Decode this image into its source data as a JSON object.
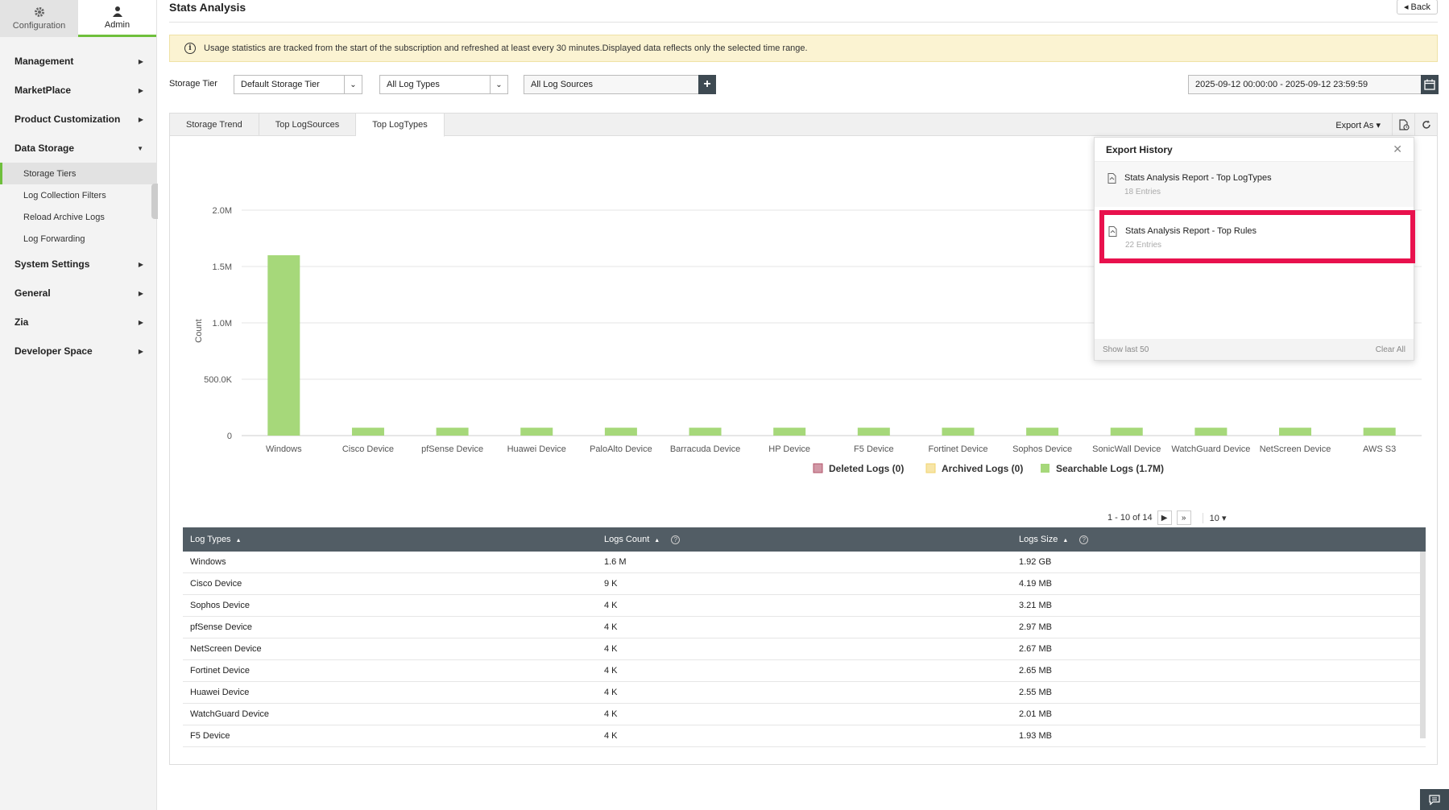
{
  "topnav": {
    "config_label": "Configuration",
    "admin_label": "Admin"
  },
  "sidebar": {
    "items": [
      {
        "label": "Management"
      },
      {
        "label": "MarketPlace"
      },
      {
        "label": "Product Customization"
      },
      {
        "label": "Data Storage"
      },
      {
        "label": "System Settings"
      },
      {
        "label": "General"
      },
      {
        "label": "Zia"
      },
      {
        "label": "Developer Space"
      }
    ],
    "data_storage_sub": [
      "Storage Tiers",
      "Log Collection Filters",
      "Reload Archive Logs",
      "Log Forwarding"
    ]
  },
  "header": {
    "title": "Stats Analysis",
    "back_label": "Back"
  },
  "notice": {
    "text": "Usage statistics are tracked from the start of the subscription and refreshed at least every 30 minutes.Displayed data reflects only the selected time range."
  },
  "filters": {
    "storage_tier_label": "Storage Tier",
    "storage_tier_value": "Default Storage Tier",
    "log_types_value": "All Log Types",
    "log_sources_value": "All Log Sources",
    "date_range": "2025-09-12 00:00:00 - 2025-09-12 23:59:59"
  },
  "tabs": [
    "Storage Trend",
    "Top LogSources",
    "Top LogTypes"
  ],
  "active_tab": "Top LogTypes",
  "export_label": "Export As",
  "colors": {
    "searchable": "#a6d87a",
    "deleted": "#b3536a",
    "archived": "#f1d36c",
    "highlight": "#e8114d",
    "header_dark": "#525d65"
  },
  "chart_data": {
    "type": "bar",
    "categories": [
      "Windows",
      "Cisco Device",
      "pfSense Device",
      "Huawei Device",
      "PaloAlto Device",
      "Barracuda Device",
      "HP Device",
      "F5 Device",
      "Fortinet Device",
      "Sophos Device",
      "SonicWall Device",
      "WatchGuard Device",
      "NetScreen Device",
      "AWS S3"
    ],
    "series": [
      {
        "name": "Searchable Logs (1.7M)",
        "values": [
          1600000,
          70000,
          70000,
          70000,
          70000,
          70000,
          70000,
          70000,
          70000,
          70000,
          70000,
          70000,
          70000,
          70000
        ]
      }
    ],
    "legend": [
      "Deleted Logs (0)",
      "Archived Logs (0)",
      "Searchable Logs (1.7M)"
    ],
    "ylabel": "Count",
    "yticks": [
      "0",
      "500.0K",
      "1.0M",
      "1.5M",
      "2.0M"
    ],
    "ylim": [
      0,
      2000000
    ],
    "grid": true,
    "legend_placement": "bottom"
  },
  "export_history": {
    "title": "Export History",
    "entries": [
      {
        "title": "Stats Analysis Report - Top LogTypes",
        "sub": "18 Entries"
      },
      {
        "title": "Stats Analysis Report - Top Rules",
        "sub": "22 Entries"
      }
    ],
    "show_last": "Show last 50",
    "clear_all": "Clear All"
  },
  "pager": {
    "range": "1 - 10 of 14",
    "per_page": "10"
  },
  "table": {
    "headers": [
      "Log Types",
      "Logs Count",
      "Logs Size"
    ],
    "rows": [
      [
        "Windows",
        "1.6 M",
        "1.92 GB"
      ],
      [
        "Cisco Device",
        "9 K",
        "4.19 MB"
      ],
      [
        "Sophos Device",
        "4 K",
        "3.21 MB"
      ],
      [
        "pfSense Device",
        "4 K",
        "2.97 MB"
      ],
      [
        "NetScreen Device",
        "4 K",
        "2.67 MB"
      ],
      [
        "Fortinet Device",
        "4 K",
        "2.65 MB"
      ],
      [
        "Huawei Device",
        "4 K",
        "2.55 MB"
      ],
      [
        "WatchGuard Device",
        "4 K",
        "2.01 MB"
      ],
      [
        "F5 Device",
        "4 K",
        "1.93 MB"
      ]
    ]
  }
}
